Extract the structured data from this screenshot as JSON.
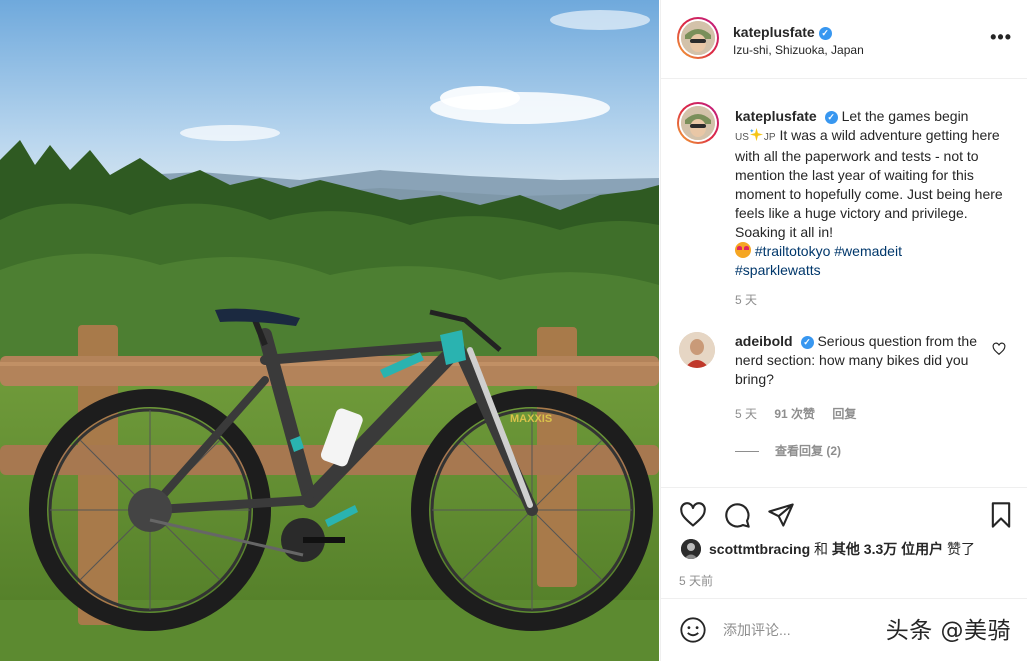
{
  "post": {
    "username": "kateplusfate",
    "verified_icon": "verified-badge-icon",
    "location": "Izu-shi, Shizuoka, Japan",
    "more_label": "•••"
  },
  "caption": {
    "username": "kateplusfate",
    "text_1": "Let the games begin",
    "flag_us": "US",
    "flag_jp": "JP",
    "text_2": "It was a wild adventure getting here with all the paperwork and tests - not to mention the last year of waiting for this moment to hopefully come. Just being here feels like a huge victory and privilege. Soaking it all in!",
    "hashtags": [
      "#trailtotokyo",
      "#wemadeit",
      "#sparklewatts"
    ],
    "time": "5 天"
  },
  "reply": {
    "username": "adeibold",
    "text": "Serious question from the nerd section: how many bikes did you bring?",
    "time": "5 天",
    "likes": "91 次赞",
    "reply_label": "回复",
    "view_replies": "查看回复 (2)"
  },
  "likes": {
    "user": "scottmtbracing",
    "and": "和",
    "others": "其他 3.3万 位用户",
    "liked": "赞了"
  },
  "post_time": "5 天前",
  "comment": {
    "placeholder": "添加评论..."
  },
  "watermark": "头条 @美骑",
  "colors": {
    "accent_link": "#00376b",
    "verified": "#3897f0",
    "muted": "#8e8e8e"
  }
}
